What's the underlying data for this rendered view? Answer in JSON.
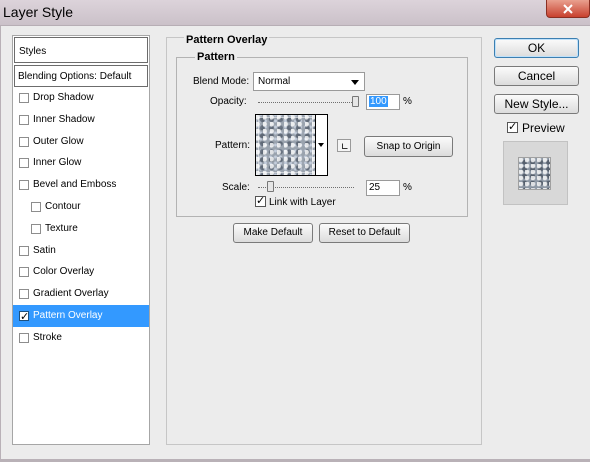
{
  "window": {
    "title": "Layer Style"
  },
  "styles_panel": {
    "header": "Styles",
    "blending_options": "Blending Options: Default",
    "items": [
      {
        "label": "Drop Shadow",
        "checked": false,
        "indent": false,
        "selected": false
      },
      {
        "label": "Inner Shadow",
        "checked": false,
        "indent": false,
        "selected": false
      },
      {
        "label": "Outer Glow",
        "checked": false,
        "indent": false,
        "selected": false
      },
      {
        "label": "Inner Glow",
        "checked": false,
        "indent": false,
        "selected": false
      },
      {
        "label": "Bevel and Emboss",
        "checked": false,
        "indent": false,
        "selected": false
      },
      {
        "label": "Contour",
        "checked": false,
        "indent": true,
        "selected": false
      },
      {
        "label": "Texture",
        "checked": false,
        "indent": true,
        "selected": false
      },
      {
        "label": "Satin",
        "checked": false,
        "indent": false,
        "selected": false
      },
      {
        "label": "Color Overlay",
        "checked": false,
        "indent": false,
        "selected": false
      },
      {
        "label": "Gradient Overlay",
        "checked": false,
        "indent": false,
        "selected": false
      },
      {
        "label": "Pattern Overlay",
        "checked": true,
        "indent": false,
        "selected": true
      },
      {
        "label": "Stroke",
        "checked": false,
        "indent": false,
        "selected": false
      }
    ]
  },
  "pattern_overlay": {
    "title": "Pattern Overlay",
    "pattern_group_title": "Pattern",
    "blend_mode_label": "Blend Mode:",
    "blend_mode_value": "Normal",
    "opacity_label": "Opacity:",
    "opacity_value": "100",
    "opacity_level": 1.0,
    "percent_sign": "%",
    "pattern_label": "Pattern:",
    "snap_to_origin": "Snap to Origin",
    "scale_label": "Scale:",
    "scale_value": "25",
    "scale_level": 0.1,
    "link_with_layer_label": "Link with Layer",
    "link_with_layer_checked": true,
    "make_default": "Make Default",
    "reset_to_default": "Reset to Default"
  },
  "buttons": {
    "ok": "OK",
    "cancel": "Cancel",
    "new_style": "New Style...",
    "preview_label": "Preview",
    "preview_checked": true
  },
  "icons": {
    "close": "close-icon",
    "check": "check-icon",
    "dropdown": "chevron-down-icon",
    "new_preset": "new-preset-icon"
  }
}
